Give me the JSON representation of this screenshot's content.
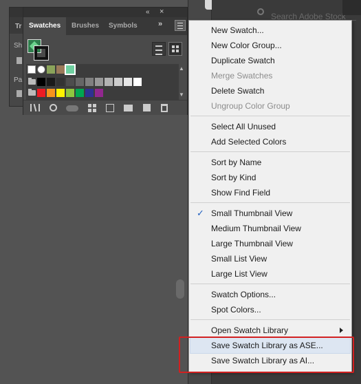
{
  "background_panel": {
    "tab_partial": "Tr",
    "label_sh": "Sh",
    "label_pa": "Pa"
  },
  "panel": {
    "collapse_icon": "«",
    "close_icon": "×",
    "tabs": [
      "Swatches",
      "Brushes",
      "Symbols"
    ],
    "active_tab": "Swatches",
    "more_tabs_icon": "»",
    "fill_color": "#2f7d4c",
    "swatch_colors": {
      "grays": [
        "#000000",
        "#1a1a1a",
        "#333333",
        "#4d4d4d",
        "#666666",
        "#808080",
        "#999999",
        "#b3b3b3",
        "#cccccc",
        "#e6e6e6",
        "#ffffff"
      ],
      "brights": [
        "#ed1c24",
        "#f7941d",
        "#fff200",
        "#8dc63f",
        "#00a651",
        "#2e3192",
        "#92278f"
      ]
    },
    "bottom_icons": [
      "swatch-libraries-icon",
      "show-kinds-icon",
      "cloud-icon",
      "new-color-group-icon",
      "swatch-options-icon",
      "new-folder-icon",
      "new-swatch-icon",
      "delete-icon"
    ]
  },
  "search": {
    "placeholder": "Search Adobe Stock"
  },
  "menu": {
    "items": [
      {
        "label": "New Swatch...",
        "disabled": false
      },
      {
        "label": "New Color Group...",
        "disabled": false
      },
      {
        "label": "Duplicate Swatch",
        "disabled": false
      },
      {
        "label": "Merge Swatches",
        "disabled": true
      },
      {
        "label": "Delete Swatch",
        "disabled": false
      },
      {
        "label": "Ungroup Color Group",
        "disabled": true
      },
      {
        "label": "Select All Unused",
        "disabled": false
      },
      {
        "label": "Add Selected Colors",
        "disabled": false
      },
      {
        "label": "Sort by Name",
        "disabled": false
      },
      {
        "label": "Sort by Kind",
        "disabled": false
      },
      {
        "label": "Show Find Field",
        "disabled": false
      },
      {
        "label": "Small Thumbnail View",
        "checked": true
      },
      {
        "label": "Medium Thumbnail View",
        "disabled": false
      },
      {
        "label": "Large Thumbnail View",
        "disabled": false
      },
      {
        "label": "Small List View",
        "disabled": false
      },
      {
        "label": "Large List View",
        "disabled": false
      },
      {
        "label": "Swatch Options...",
        "disabled": false
      },
      {
        "label": "Spot Colors...",
        "disabled": false
      },
      {
        "label": "Open Swatch Library",
        "submenu": true
      },
      {
        "label": "Save Swatch Library as ASE...",
        "hovered": true
      },
      {
        "label": "Save Swatch Library as AI...",
        "disabled": false
      }
    ],
    "check_mark": "✓",
    "highlight_color": "#d22020"
  }
}
